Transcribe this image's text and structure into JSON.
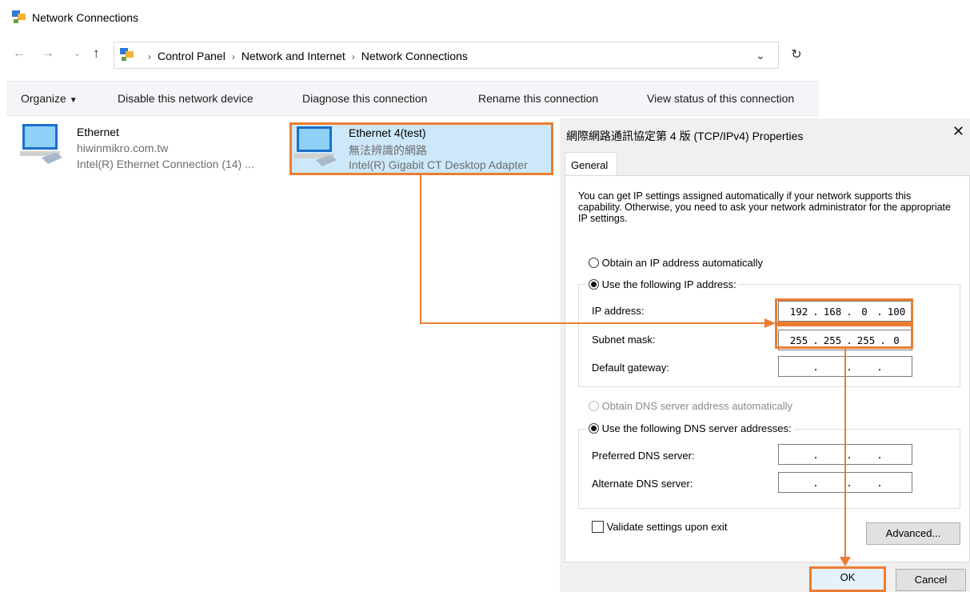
{
  "window": {
    "title": "Network Connections",
    "icon": "network-connections-icon"
  },
  "address_bar": {
    "icon": "control-panel-icon",
    "breadcrumbs": [
      "Control Panel",
      "Network and Internet",
      "Network Connections"
    ]
  },
  "command_bar": {
    "organize": "Organize",
    "disable": "Disable this network device",
    "diagnose": "Diagnose this connection",
    "rename": "Rename this connection",
    "view_status": "View status of this connection"
  },
  "connections": [
    {
      "name": "Ethernet",
      "network": "hiwinmikro.com.tw",
      "adapter": "Intel(R) Ethernet Connection (14) ...",
      "icon": "ethernet-adapter-icon"
    },
    {
      "name": "Ethernet 4(test)",
      "network": "無法辨識的網路",
      "adapter": "Intel(R) Gigabit CT Desktop Adapter",
      "icon": "ethernet-adapter-icon"
    }
  ],
  "dialog": {
    "title": "網際網路通訊協定第 4 版 (TCP/IPv4) Properties",
    "tab": "General",
    "description": "You can get IP settings assigned automatically if your network supports this capability. Otherwise, you need to ask your network administrator for the appropriate IP settings.",
    "ip_auto": "Obtain an IP address automatically",
    "ip_manual": "Use the following IP address:",
    "ip_label": "IP address:",
    "ip_value": [
      "192",
      "168",
      "0",
      "100"
    ],
    "subnet_label": "Subnet mask:",
    "subnet_value": [
      "255",
      "255",
      "255",
      "0"
    ],
    "gateway_label": "Default gateway:",
    "dns_auto": "Obtain DNS server address automatically",
    "dns_manual": "Use the following DNS server addresses:",
    "preferred_dns_label": "Preferred DNS server:",
    "alternate_dns_label": "Alternate DNS server:",
    "validate": "Validate settings upon exit",
    "advanced": "Advanced...",
    "ok": "OK",
    "cancel": "Cancel"
  },
  "colors": {
    "highlight": "#ed7d31",
    "selection": "#cde8fb"
  }
}
